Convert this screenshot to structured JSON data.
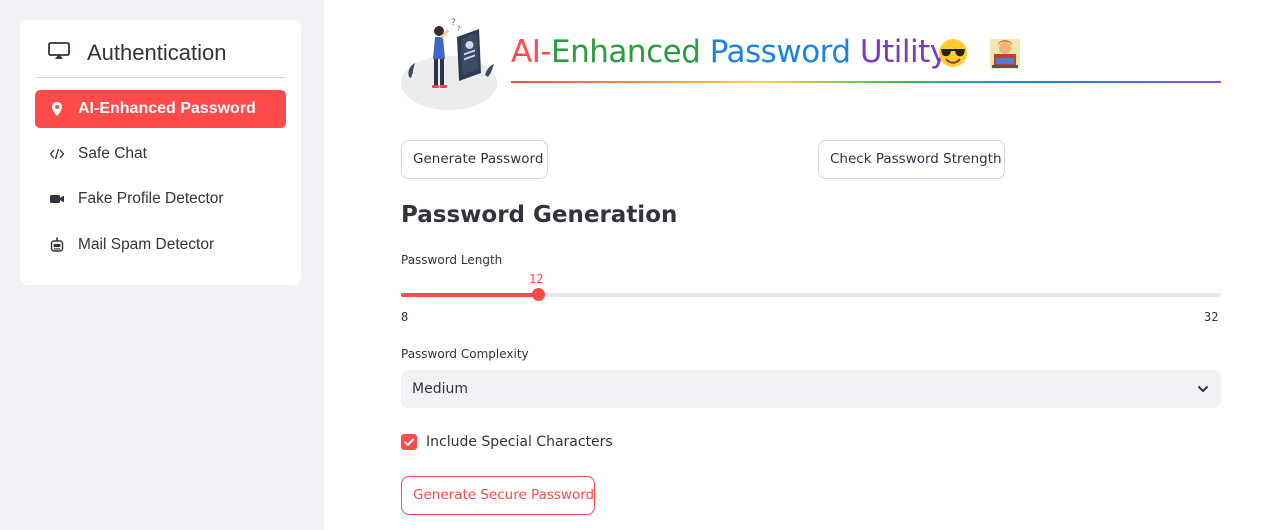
{
  "sidebar": {
    "header": {
      "title": "Authentication",
      "icon": "display-icon"
    },
    "items": [
      {
        "label": "AI-Enhanced Password",
        "icon": "location-pin-icon",
        "active": true
      },
      {
        "label": "Safe Chat",
        "icon": "code-icon",
        "active": false
      },
      {
        "label": "Fake Profile Detector",
        "icon": "video-camera-icon",
        "active": false
      },
      {
        "label": "Mail Spam Detector",
        "icon": "robot-icon",
        "active": false
      }
    ]
  },
  "main": {
    "title_parts": [
      "AI-",
      "Enhanced ",
      "Password ",
      "Utility"
    ],
    "title_emojis": [
      "smiling-face-with-sunglasses-icon",
      "technologist-icon"
    ],
    "buttons": {
      "generate": "Generate Password",
      "check": "Check Password Strength"
    },
    "section_title": "Password Generation",
    "slider": {
      "label": "Password Length",
      "value": "12",
      "min": "8",
      "max": "32",
      "fraction": 0.1667
    },
    "complexity": {
      "label": "Password Complexity",
      "selected": "Medium"
    },
    "checkbox": {
      "label": "Include Special Characters",
      "checked": true
    },
    "secure_button": "Generate Secure Password"
  },
  "colors": {
    "accent": "#ff4b4b",
    "sidebar_bg": "#f0f2f6",
    "text": "#31333f"
  }
}
